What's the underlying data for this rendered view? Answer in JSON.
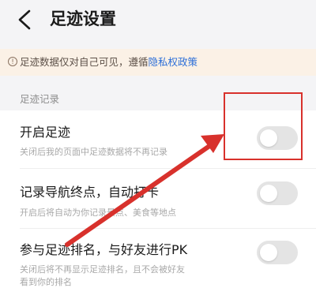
{
  "header": {
    "title": "足迹设置",
    "back_icon": "chevron-left-icon"
  },
  "notice": {
    "icon": "info-icon",
    "text": "足迹数据仅对自己可见，遵循",
    "link": "隐私权政策"
  },
  "section": {
    "label": "足迹记录"
  },
  "settings": [
    {
      "title": "开启足迹",
      "desc": "关闭后我的页面中足迹数据将不再记录",
      "enabled": false
    },
    {
      "title": "记录导航终点，自动打卡",
      "desc": "开启后将自动为你记录景点、美食等地点",
      "enabled": false
    },
    {
      "title": "参与足迹排名，与好友进行PK",
      "desc": "关闭后将不再显示足迹排名，且不会被好友",
      "desc2": "看到你的排名",
      "enabled": false
    }
  ],
  "colors": {
    "background": "#f4f4f6",
    "notice_bg": "#fbf1e6",
    "link": "#2d6fd8",
    "annotation_red": "#d8312c",
    "toggle_off": "#e4e4e4"
  },
  "annotations": {
    "highlight": "red-box-around-first-toggle",
    "pointer": "red-arrow-pointing-at-toggle"
  }
}
